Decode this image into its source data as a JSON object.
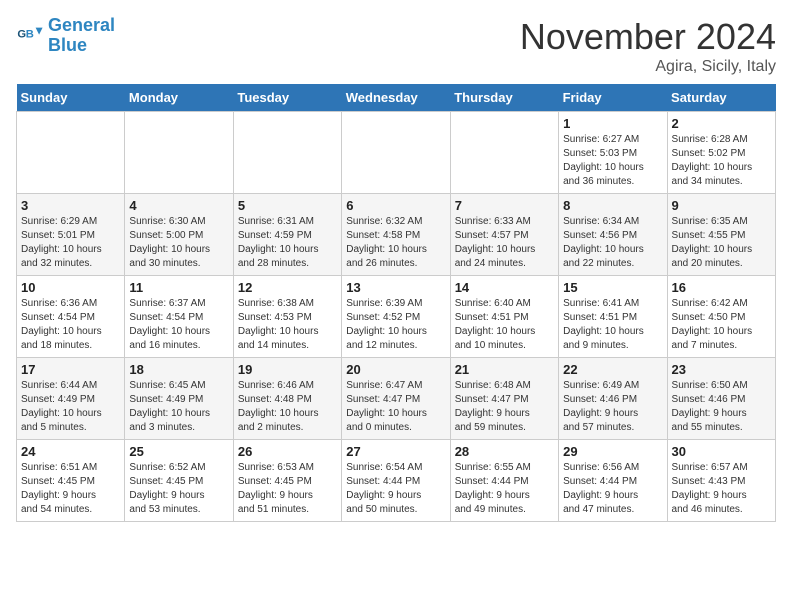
{
  "header": {
    "logo_line1": "General",
    "logo_line2": "Blue",
    "month": "November 2024",
    "location": "Agira, Sicily, Italy"
  },
  "days_of_week": [
    "Sunday",
    "Monday",
    "Tuesday",
    "Wednesday",
    "Thursday",
    "Friday",
    "Saturday"
  ],
  "weeks": [
    [
      {
        "day": "",
        "info": ""
      },
      {
        "day": "",
        "info": ""
      },
      {
        "day": "",
        "info": ""
      },
      {
        "day": "",
        "info": ""
      },
      {
        "day": "",
        "info": ""
      },
      {
        "day": "1",
        "info": "Sunrise: 6:27 AM\nSunset: 5:03 PM\nDaylight: 10 hours\nand 36 minutes."
      },
      {
        "day": "2",
        "info": "Sunrise: 6:28 AM\nSunset: 5:02 PM\nDaylight: 10 hours\nand 34 minutes."
      }
    ],
    [
      {
        "day": "3",
        "info": "Sunrise: 6:29 AM\nSunset: 5:01 PM\nDaylight: 10 hours\nand 32 minutes."
      },
      {
        "day": "4",
        "info": "Sunrise: 6:30 AM\nSunset: 5:00 PM\nDaylight: 10 hours\nand 30 minutes."
      },
      {
        "day": "5",
        "info": "Sunrise: 6:31 AM\nSunset: 4:59 PM\nDaylight: 10 hours\nand 28 minutes."
      },
      {
        "day": "6",
        "info": "Sunrise: 6:32 AM\nSunset: 4:58 PM\nDaylight: 10 hours\nand 26 minutes."
      },
      {
        "day": "7",
        "info": "Sunrise: 6:33 AM\nSunset: 4:57 PM\nDaylight: 10 hours\nand 24 minutes."
      },
      {
        "day": "8",
        "info": "Sunrise: 6:34 AM\nSunset: 4:56 PM\nDaylight: 10 hours\nand 22 minutes."
      },
      {
        "day": "9",
        "info": "Sunrise: 6:35 AM\nSunset: 4:55 PM\nDaylight: 10 hours\nand 20 minutes."
      }
    ],
    [
      {
        "day": "10",
        "info": "Sunrise: 6:36 AM\nSunset: 4:54 PM\nDaylight: 10 hours\nand 18 minutes."
      },
      {
        "day": "11",
        "info": "Sunrise: 6:37 AM\nSunset: 4:54 PM\nDaylight: 10 hours\nand 16 minutes."
      },
      {
        "day": "12",
        "info": "Sunrise: 6:38 AM\nSunset: 4:53 PM\nDaylight: 10 hours\nand 14 minutes."
      },
      {
        "day": "13",
        "info": "Sunrise: 6:39 AM\nSunset: 4:52 PM\nDaylight: 10 hours\nand 12 minutes."
      },
      {
        "day": "14",
        "info": "Sunrise: 6:40 AM\nSunset: 4:51 PM\nDaylight: 10 hours\nand 10 minutes."
      },
      {
        "day": "15",
        "info": "Sunrise: 6:41 AM\nSunset: 4:51 PM\nDaylight: 10 hours\nand 9 minutes."
      },
      {
        "day": "16",
        "info": "Sunrise: 6:42 AM\nSunset: 4:50 PM\nDaylight: 10 hours\nand 7 minutes."
      }
    ],
    [
      {
        "day": "17",
        "info": "Sunrise: 6:44 AM\nSunset: 4:49 PM\nDaylight: 10 hours\nand 5 minutes."
      },
      {
        "day": "18",
        "info": "Sunrise: 6:45 AM\nSunset: 4:49 PM\nDaylight: 10 hours\nand 3 minutes."
      },
      {
        "day": "19",
        "info": "Sunrise: 6:46 AM\nSunset: 4:48 PM\nDaylight: 10 hours\nand 2 minutes."
      },
      {
        "day": "20",
        "info": "Sunrise: 6:47 AM\nSunset: 4:47 PM\nDaylight: 10 hours\nand 0 minutes."
      },
      {
        "day": "21",
        "info": "Sunrise: 6:48 AM\nSunset: 4:47 PM\nDaylight: 9 hours\nand 59 minutes."
      },
      {
        "day": "22",
        "info": "Sunrise: 6:49 AM\nSunset: 4:46 PM\nDaylight: 9 hours\nand 57 minutes."
      },
      {
        "day": "23",
        "info": "Sunrise: 6:50 AM\nSunset: 4:46 PM\nDaylight: 9 hours\nand 55 minutes."
      }
    ],
    [
      {
        "day": "24",
        "info": "Sunrise: 6:51 AM\nSunset: 4:45 PM\nDaylight: 9 hours\nand 54 minutes."
      },
      {
        "day": "25",
        "info": "Sunrise: 6:52 AM\nSunset: 4:45 PM\nDaylight: 9 hours\nand 53 minutes."
      },
      {
        "day": "26",
        "info": "Sunrise: 6:53 AM\nSunset: 4:45 PM\nDaylight: 9 hours\nand 51 minutes."
      },
      {
        "day": "27",
        "info": "Sunrise: 6:54 AM\nSunset: 4:44 PM\nDaylight: 9 hours\nand 50 minutes."
      },
      {
        "day": "28",
        "info": "Sunrise: 6:55 AM\nSunset: 4:44 PM\nDaylight: 9 hours\nand 49 minutes."
      },
      {
        "day": "29",
        "info": "Sunrise: 6:56 AM\nSunset: 4:44 PM\nDaylight: 9 hours\nand 47 minutes."
      },
      {
        "day": "30",
        "info": "Sunrise: 6:57 AM\nSunset: 4:43 PM\nDaylight: 9 hours\nand 46 minutes."
      }
    ]
  ]
}
